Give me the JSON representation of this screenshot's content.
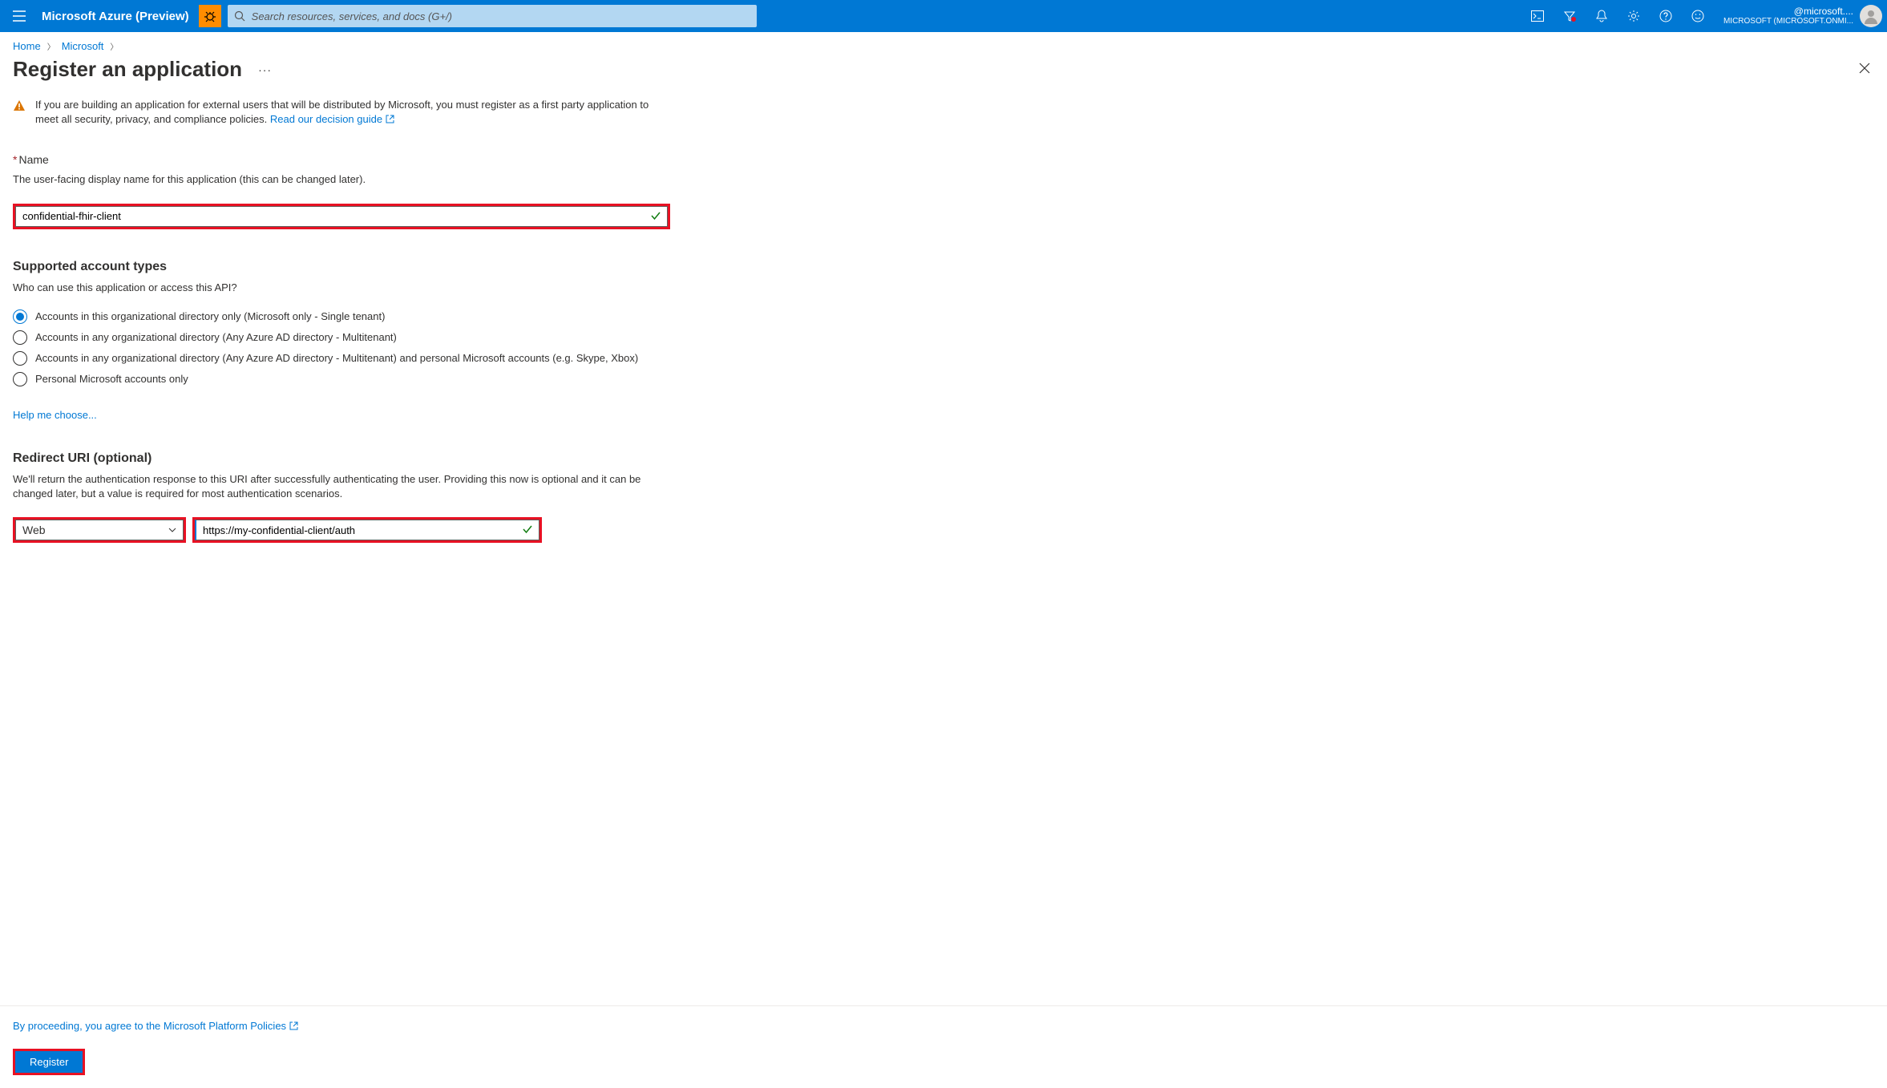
{
  "topbar": {
    "brand": "Microsoft Azure (Preview)",
    "search_placeholder": "Search resources, services, and docs (G+/)",
    "account_name": "@microsoft....",
    "account_org": "MICROSOFT (MICROSOFT.ONMI..."
  },
  "breadcrumb": {
    "items": [
      "Home",
      "Microsoft"
    ]
  },
  "page": {
    "title": "Register an application"
  },
  "callout": {
    "text": "If you are building an application for external users that will be distributed by Microsoft, you must register as a first party application to meet all security, privacy, and compliance policies. ",
    "link": "Read our decision guide"
  },
  "name_section": {
    "label": "Name",
    "sub": "The user-facing display name for this application (this can be changed later).",
    "value": "confidential-fhir-client"
  },
  "account_types": {
    "heading": "Supported account types",
    "sub": "Who can use this application or access this API?",
    "options": [
      "Accounts in this organizational directory only (Microsoft only - Single tenant)",
      "Accounts in any organizational directory (Any Azure AD directory - Multitenant)",
      "Accounts in any organizational directory (Any Azure AD directory - Multitenant) and personal Microsoft accounts (e.g. Skype, Xbox)",
      "Personal Microsoft accounts only"
    ],
    "selected_index": 0,
    "help_link": "Help me choose..."
  },
  "redirect_uri": {
    "heading": "Redirect URI (optional)",
    "sub": "We'll return the authentication response to this URI after successfully authenticating the user. Providing this now is optional and it can be changed later, but a value is required for most authentication scenarios.",
    "platform": "Web",
    "uri": "https://my-confidential-client/auth"
  },
  "footer": {
    "policy_text": "By proceeding, you agree to the Microsoft Platform Policies",
    "register_label": "Register"
  }
}
